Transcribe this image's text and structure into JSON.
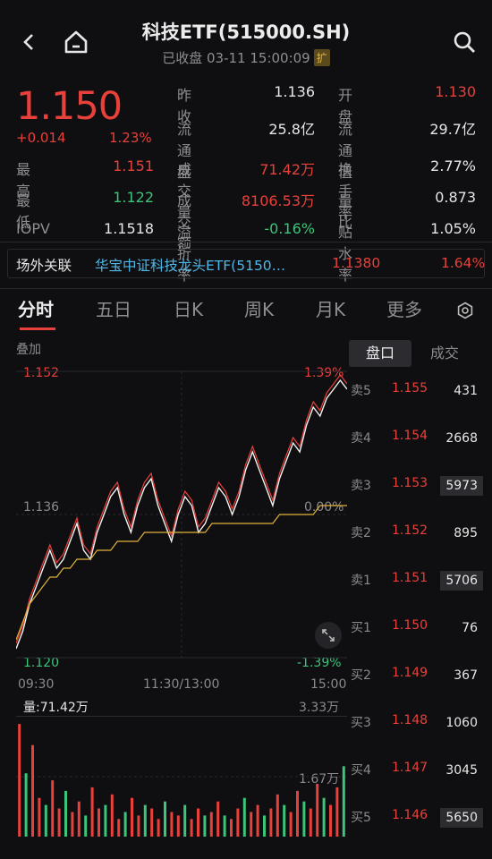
{
  "header": {
    "title": "科技ETF(515000.SH)",
    "status": "已收盘 03-11 15:00:09",
    "badge": "扩"
  },
  "quote": {
    "price": "1.150",
    "change": "+0.014",
    "change_pct": "1.23%",
    "rows": [
      {
        "l1": "最　高",
        "v1": "1.151",
        "l2": "昨收",
        "v2": "1.136",
        "l3": "开盘",
        "v3": "1.130"
      },
      {
        "l1": "最　低",
        "v1": "1.122",
        "l2": "流通盘",
        "v2": "25.8亿",
        "l3": "流通值",
        "v3": "29.7亿"
      },
      {
        "l1": "IOPV",
        "v1": "1.1518",
        "l2": "成交量",
        "v2": "71.42万",
        "l3": "换手率",
        "v3": "2.77%"
      },
      {
        "l2": "成交额",
        "v2": "8106.53万",
        "l3": "量　比",
        "v3": "0.873"
      },
      {
        "l2": "溢折率",
        "v2": "-0.16%",
        "l3": "贴水率",
        "v3": "1.05%"
      }
    ]
  },
  "linked": {
    "label": "场外关联",
    "fund": "华宝中证科技龙头ETF(5150…",
    "price": "1.1380",
    "pct": "1.64%"
  },
  "tabs": [
    "分时",
    "五日",
    "日K",
    "周K",
    "月K",
    "更多"
  ],
  "chart": {
    "overlay_label": "叠加",
    "y_top": "1.152",
    "y_mid": "1.136",
    "y_bot": "1.120",
    "pct_top": "1.39%",
    "pct_mid": "0.00%",
    "pct_bot": "-1.39%",
    "x_labels": [
      "09:30",
      "11:30/13:00",
      "15:00"
    ],
    "vol_label": "量:71.42万",
    "vol_top": "3.33万",
    "vol_mid": "1.67万"
  },
  "orderbook": {
    "tabs": [
      "盘口",
      "成交"
    ],
    "rows": [
      {
        "side": "卖5",
        "price": "1.155",
        "vol": "431",
        "hl": false
      },
      {
        "side": "卖4",
        "price": "1.154",
        "vol": "2668",
        "hl": false
      },
      {
        "side": "卖3",
        "price": "1.153",
        "vol": "5973",
        "hl": true
      },
      {
        "side": "卖2",
        "price": "1.152",
        "vol": "895",
        "hl": false
      },
      {
        "side": "卖1",
        "price": "1.151",
        "vol": "5706",
        "hl": true
      },
      {
        "side": "买1",
        "price": "1.150",
        "vol": "76",
        "hl": false
      },
      {
        "side": "买2",
        "price": "1.149",
        "vol": "367",
        "hl": false
      },
      {
        "side": "买3",
        "price": "1.148",
        "vol": "1060",
        "hl": false
      },
      {
        "side": "买4",
        "price": "1.147",
        "vol": "3045",
        "hl": false
      },
      {
        "side": "买5",
        "price": "1.146",
        "vol": "5650",
        "hl": true
      }
    ]
  },
  "chart_data": {
    "type": "line",
    "ylim": [
      1.12,
      1.152
    ],
    "series": [
      {
        "values": [
          1.121,
          1.123,
          1.126,
          1.128,
          1.13,
          1.132,
          1.13,
          1.131,
          1.133,
          1.135,
          1.132,
          1.131,
          1.134,
          1.136,
          1.138,
          1.139,
          1.136,
          1.134,
          1.137,
          1.139,
          1.14,
          1.137,
          1.135,
          1.133,
          1.136,
          1.138,
          1.137,
          1.134,
          1.135,
          1.137,
          1.139,
          1.138,
          1.136,
          1.138,
          1.141,
          1.143,
          1.141,
          1.139,
          1.137,
          1.14,
          1.142,
          1.144,
          1.143,
          1.146,
          1.148,
          1.147,
          1.149,
          1.15,
          1.151,
          1.15
        ]
      },
      {
        "values": [
          1.122,
          1.124,
          1.126,
          1.127,
          1.128,
          1.129,
          1.129,
          1.13,
          1.13,
          1.131,
          1.131,
          1.131,
          1.132,
          1.132,
          1.132,
          1.133,
          1.133,
          1.133,
          1.133,
          1.134,
          1.134,
          1.134,
          1.134,
          1.134,
          1.134,
          1.134,
          1.134,
          1.134,
          1.134,
          1.135,
          1.135,
          1.135,
          1.135,
          1.135,
          1.135,
          1.135,
          1.135,
          1.135,
          1.135,
          1.136,
          1.136,
          1.136,
          1.136,
          1.136,
          1.136,
          1.137,
          1.137,
          1.137,
          1.137,
          1.137
        ]
      }
    ],
    "volume": [
      3.2,
      1.8,
      2.6,
      1.1,
      0.9,
      1.6,
      0.8,
      1.3,
      0.7,
      1.0,
      0.6,
      1.4,
      0.8,
      0.9,
      1.2,
      0.5,
      0.7,
      1.1,
      0.6,
      0.9,
      0.8,
      0.5,
      1.0,
      0.7,
      0.6,
      0.9,
      0.5,
      0.8,
      0.6,
      0.7,
      1.0,
      0.6,
      0.5,
      0.8,
      1.1,
      0.7,
      0.9,
      0.6,
      0.8,
      1.2,
      0.9,
      0.7,
      1.3,
      1.0,
      0.8,
      1.5,
      1.1,
      0.9,
      1.4,
      2.0
    ],
    "vol_ylim": [
      0,
      3.33
    ]
  },
  "colors": {
    "up": "#e8403a",
    "down": "#3cc47a",
    "avg": "#e0b13a",
    "line": "#f2f2f2"
  }
}
